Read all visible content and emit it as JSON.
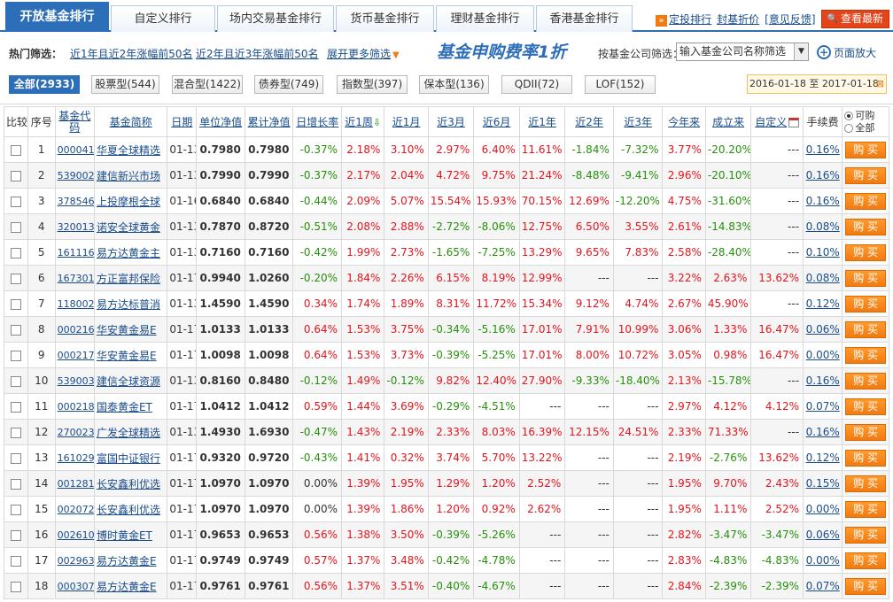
{
  "tabs": [
    "开放基金排行",
    "自定义排行",
    "场内交易基金排行",
    "货币基金排行",
    "理财基金排行",
    "香港基金排行"
  ],
  "toolbar": {
    "custom_rank": "定投排行",
    "closed_discount": "封基折价",
    "feedback": "意见反馈",
    "refresh": "查看最新"
  },
  "filter": {
    "hot_label": "热门筛选：",
    "links": [
      "近1年且近2年涨幅前50名",
      "近2年且近3年涨幅前50名",
      "展开更多筛选"
    ],
    "promo": "基金申购费率1折",
    "company_label": "按基金公司筛选：",
    "company_select": "输入基金公司名称筛选",
    "zoom": "页面放大"
  },
  "types": [
    {
      "label": "全部",
      "count": "(2933)"
    },
    {
      "label": "股票型",
      "count": "(544)"
    },
    {
      "label": "混合型",
      "count": "(1422)"
    },
    {
      "label": "债券型",
      "count": "(749)"
    },
    {
      "label": "指数型",
      "count": "(397)"
    },
    {
      "label": "保本型",
      "count": "(136)"
    },
    {
      "label": "QDII",
      "count": "(72)"
    },
    {
      "label": "LOF",
      "count": "(152)"
    }
  ],
  "date_range": "2016-01-18 至 2017-01-18",
  "headers": {
    "compare": "比较",
    "seq": "序号",
    "code": "基金代码",
    "name": "基金简称",
    "date": "日期",
    "nav": "单位净值",
    "acc_nav": "累计净值",
    "day": "日增长率",
    "w1": "近1周",
    "m1": "近1月",
    "m3": "近3月",
    "m6": "近6月",
    "y1": "近1年",
    "y2": "近2年",
    "y3": "近3年",
    "ytd": "今年来",
    "since": "成立来",
    "custom": "自定义",
    "fee": "手续费",
    "opt_buy": "可购",
    "opt_all": "全部"
  },
  "buy_label": "购 买",
  "rows": [
    [
      "1",
      "000041",
      "华夏全球精选",
      "01-13",
      "0.7980",
      "0.7980",
      "-0.37%",
      "2.18%",
      "3.10%",
      "2.97%",
      "6.40%",
      "11.61%",
      "-1.84%",
      "-7.32%",
      "3.77%",
      "-20.20%",
      "---",
      "0.16%"
    ],
    [
      "2",
      "539002",
      "建信新兴市场",
      "01-13",
      "0.7990",
      "0.7990",
      "-0.37%",
      "2.17%",
      "2.04%",
      "4.72%",
      "9.75%",
      "21.24%",
      "-8.48%",
      "-9.41%",
      "2.96%",
      "-20.10%",
      "---",
      "0.16%"
    ],
    [
      "3",
      "378546",
      "上投摩根全球",
      "01-16",
      "0.6840",
      "0.6840",
      "-0.44%",
      "2.09%",
      "5.07%",
      "15.54%",
      "15.93%",
      "70.15%",
      "12.69%",
      "-12.20%",
      "4.75%",
      "-31.60%",
      "---",
      "0.16%"
    ],
    [
      "4",
      "320013",
      "诺安全球黄金",
      "01-13",
      "0.7870",
      "0.8720",
      "-0.51%",
      "2.08%",
      "2.88%",
      "-2.72%",
      "-8.06%",
      "12.75%",
      "6.50%",
      "3.55%",
      "2.61%",
      "-14.83%",
      "---",
      "0.08%"
    ],
    [
      "5",
      "161116",
      "易方达黄金主",
      "01-13",
      "0.7160",
      "0.7160",
      "-0.42%",
      "1.99%",
      "2.73%",
      "-1.65%",
      "-7.25%",
      "13.29%",
      "9.65%",
      "7.83%",
      "2.58%",
      "-28.40%",
      "---",
      "0.10%"
    ],
    [
      "6",
      "167301",
      "方正富邦保险",
      "01-17",
      "0.9940",
      "1.0260",
      "-0.20%",
      "1.84%",
      "2.26%",
      "6.15%",
      "8.19%",
      "12.99%",
      "---",
      "---",
      "3.22%",
      "2.63%",
      "13.62%",
      "0.08%"
    ],
    [
      "7",
      "118002",
      "易方达标普消",
      "01-13",
      "1.4590",
      "1.4590",
      "0.34%",
      "1.74%",
      "1.89%",
      "8.31%",
      "11.72%",
      "15.34%",
      "9.12%",
      "4.74%",
      "2.67%",
      "45.90%",
      "---",
      "0.12%"
    ],
    [
      "8",
      "000216",
      "华安黄金易E",
      "01-17",
      "1.0133",
      "1.0133",
      "0.64%",
      "1.53%",
      "3.75%",
      "-0.34%",
      "-5.16%",
      "17.01%",
      "7.91%",
      "10.99%",
      "3.06%",
      "1.33%",
      "16.47%",
      "0.06%"
    ],
    [
      "9",
      "000217",
      "华安黄金易E",
      "01-17",
      "1.0098",
      "1.0098",
      "0.64%",
      "1.53%",
      "3.73%",
      "-0.39%",
      "-5.25%",
      "17.01%",
      "8.00%",
      "10.72%",
      "3.05%",
      "0.98%",
      "16.47%",
      "0.00%"
    ],
    [
      "10",
      "539003",
      "建信全球资源",
      "01-13",
      "0.8160",
      "0.8480",
      "-0.12%",
      "1.49%",
      "-0.12%",
      "9.82%",
      "12.40%",
      "27.90%",
      "-9.33%",
      "-18.40%",
      "2.13%",
      "-15.78%",
      "---",
      "0.16%"
    ],
    [
      "11",
      "000218",
      "国泰黄金ET",
      "01-17",
      "1.0412",
      "1.0412",
      "0.59%",
      "1.44%",
      "3.69%",
      "-0.29%",
      "-4.51%",
      "---",
      "---",
      "---",
      "2.97%",
      "4.12%",
      "4.12%",
      "0.07%"
    ],
    [
      "12",
      "270023",
      "广发全球精选",
      "01-13",
      "1.4930",
      "1.6930",
      "-0.47%",
      "1.43%",
      "2.19%",
      "2.33%",
      "8.03%",
      "16.39%",
      "12.15%",
      "24.51%",
      "2.33%",
      "71.33%",
      "---",
      "0.16%"
    ],
    [
      "13",
      "161029",
      "富国中证银行",
      "01-17",
      "0.9320",
      "0.9720",
      "-0.43%",
      "1.41%",
      "0.32%",
      "3.74%",
      "5.70%",
      "13.22%",
      "---",
      "---",
      "2.19%",
      "-2.76%",
      "13.62%",
      "0.12%"
    ],
    [
      "14",
      "001281",
      "长安鑫利优选",
      "01-17",
      "1.0970",
      "1.0970",
      "0.00%",
      "1.39%",
      "1.95%",
      "1.29%",
      "1.20%",
      "2.52%",
      "---",
      "---",
      "1.95%",
      "9.70%",
      "2.43%",
      "0.15%"
    ],
    [
      "15",
      "002072",
      "长安鑫利优选",
      "01-17",
      "1.0970",
      "1.0970",
      "0.00%",
      "1.39%",
      "1.86%",
      "1.20%",
      "0.92%",
      "2.62%",
      "---",
      "---",
      "1.95%",
      "1.11%",
      "2.52%",
      "0.00%"
    ],
    [
      "16",
      "002610",
      "博时黄金ET",
      "01-17",
      "0.9653",
      "0.9653",
      "0.56%",
      "1.38%",
      "3.50%",
      "-0.39%",
      "-5.26%",
      "---",
      "---",
      "---",
      "2.82%",
      "-3.47%",
      "-3.47%",
      "0.06%"
    ],
    [
      "17",
      "002963",
      "易方达黄金E",
      "01-17",
      "0.9749",
      "0.9749",
      "0.57%",
      "1.37%",
      "3.48%",
      "-0.42%",
      "-4.78%",
      "---",
      "---",
      "---",
      "2.83%",
      "-4.83%",
      "-4.83%",
      "0.00%"
    ],
    [
      "18",
      "000307",
      "易方达黄金E",
      "01-17",
      "0.9761",
      "0.9761",
      "0.56%",
      "1.37%",
      "3.51%",
      "-0.40%",
      "-4.67%",
      "---",
      "---",
      "---",
      "2.84%",
      "-2.39%",
      "-2.39%",
      "0.07%"
    ]
  ],
  "colors": {
    "accent": "#2c6eb7",
    "up": "#e5141c",
    "down": "#25900a",
    "buy": "#f07b12"
  }
}
